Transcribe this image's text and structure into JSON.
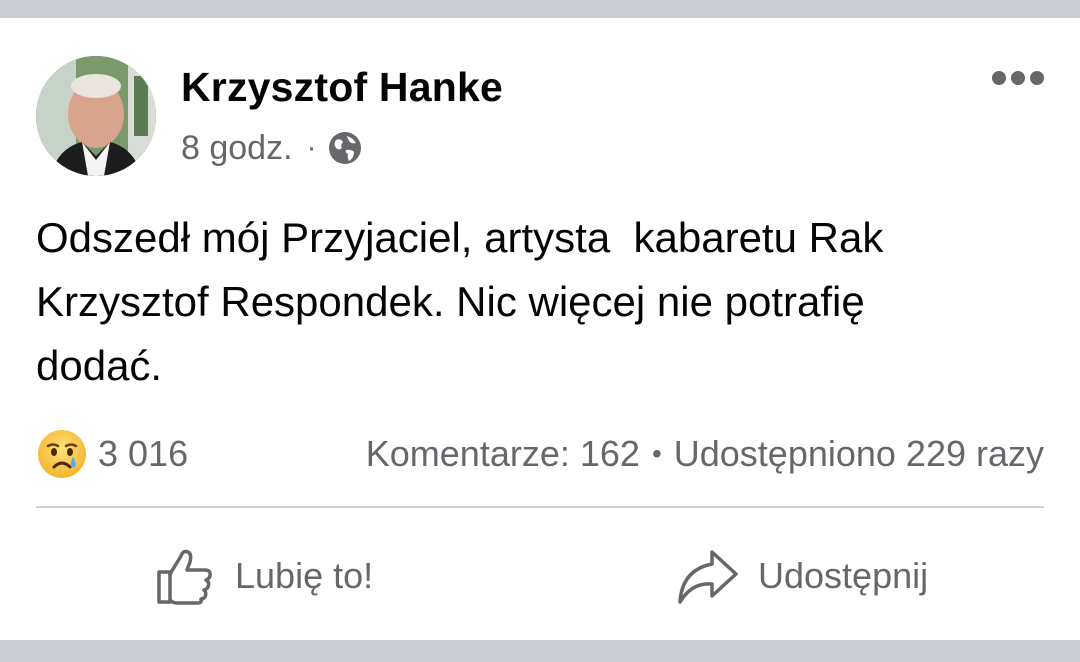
{
  "post": {
    "author": "Krzysztof Hanke",
    "time": "8 godz.",
    "privacy_icon": "globe-icon",
    "text": "Odszedł mój Przyjaciel, artysta  kabaretu Rak\nKrzysztof Respondek. Nic więcej nie potrafię\ndodać.",
    "more_icon": "more-options-icon"
  },
  "reactions": {
    "icon": "sad-emoji-icon",
    "count": "3 016"
  },
  "stats": {
    "comments": "Komentarze: 162",
    "separator": "•",
    "shares": "Udostępniono 229 razy"
  },
  "actions": {
    "like_label": "Lubię to!",
    "like_icon": "thumbs-up-icon",
    "share_label": "Udostępnij",
    "share_icon": "share-arrow-icon"
  },
  "colors": {
    "text_primary": "#050505",
    "text_secondary": "#65676b",
    "background": "#c9ccd1",
    "card": "#ffffff",
    "divider": "#ced0d4"
  }
}
